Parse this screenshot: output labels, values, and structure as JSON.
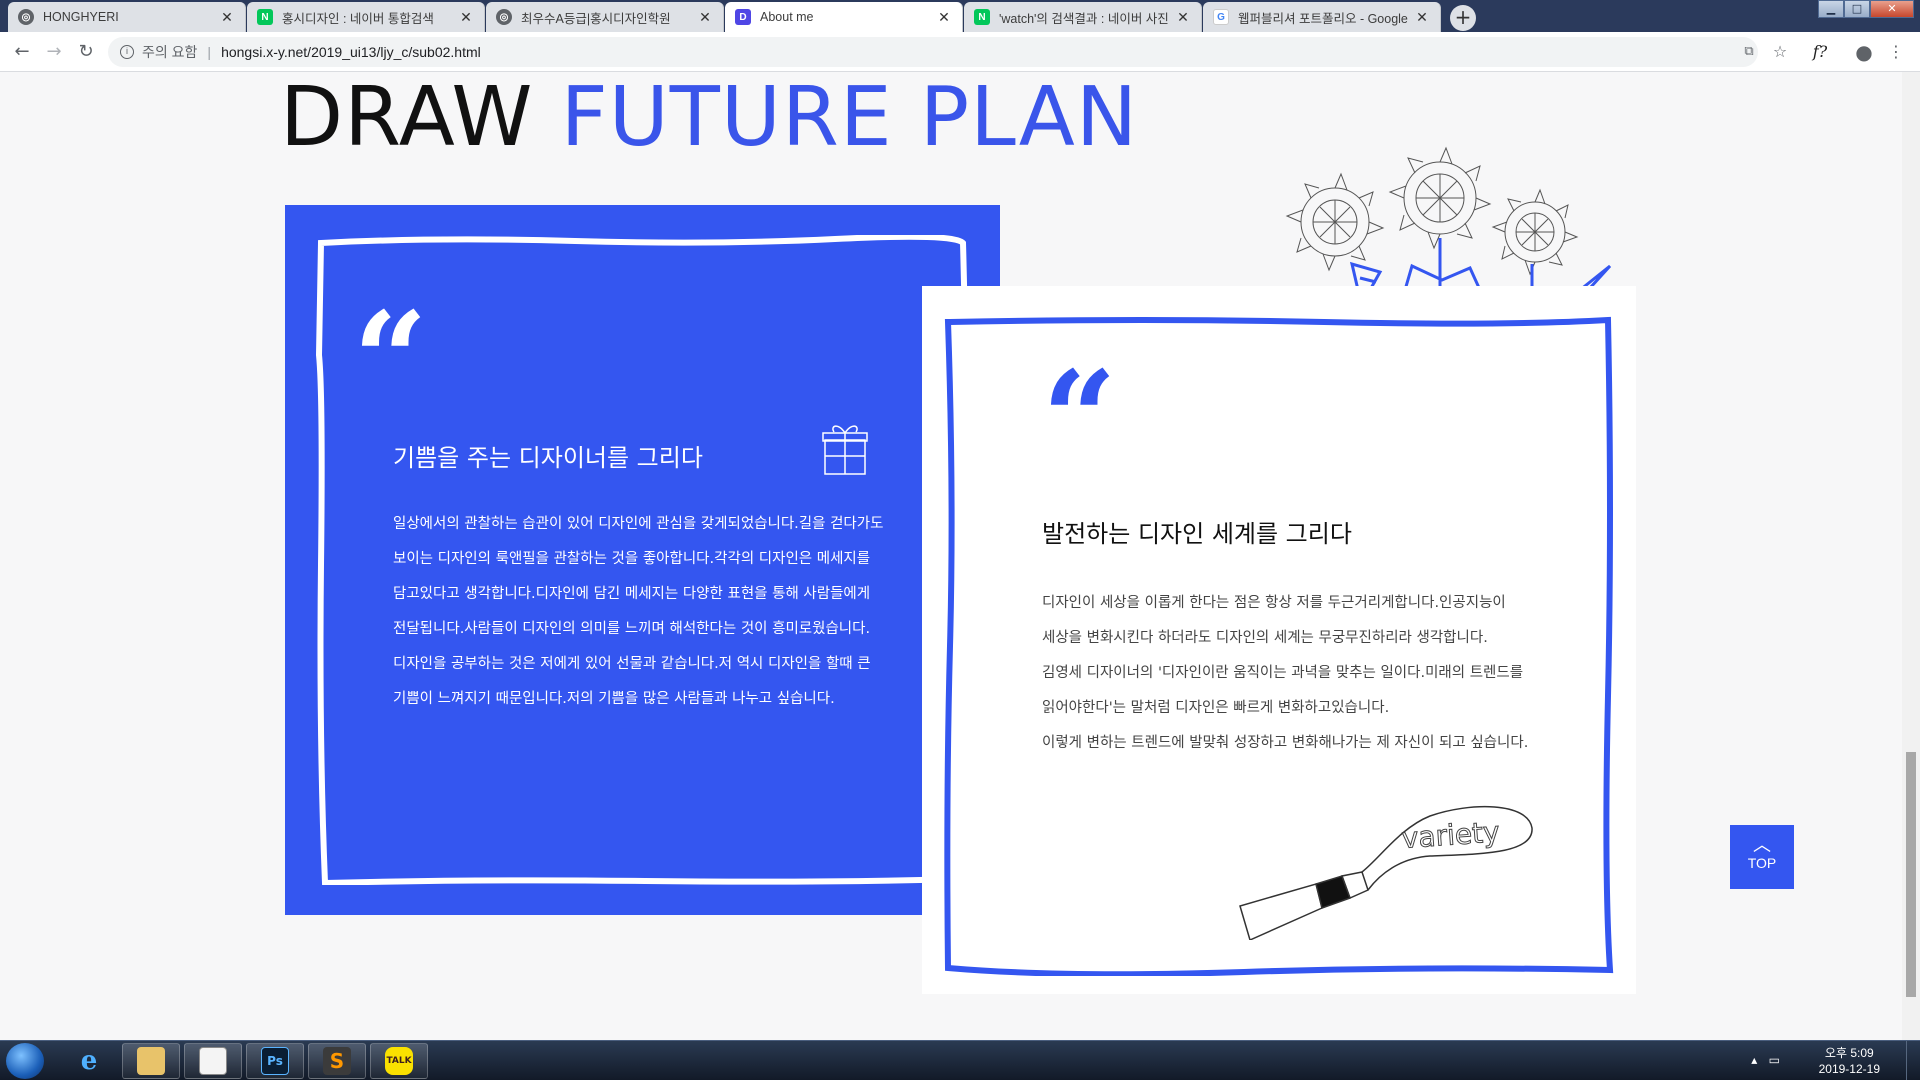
{
  "browser": {
    "tabs": [
      {
        "title": "HONGHYERI",
        "favicon": "globe-icon",
        "color": "#5f6368",
        "active": false
      },
      {
        "title": "홍시디자인 : 네이버 통합검색",
        "favicon": "naver-icon",
        "color": "#03c75a",
        "active": false
      },
      {
        "title": "최우수A등급|홍시디자인학원",
        "favicon": "globe-icon",
        "color": "#5f6368",
        "active": false
      },
      {
        "title": "About me",
        "favicon": "d-icon",
        "color": "#4f46e5",
        "active": true
      },
      {
        "title": "'watch'의 검색결과 : 네이버 사진",
        "favicon": "naver-photo-icon",
        "color": "#03c75a",
        "active": false
      },
      {
        "title": "웹퍼블리셔 포트폴리오 - Google",
        "favicon": "google-icon",
        "color": "#4285f4",
        "active": false
      }
    ],
    "security_label": "주의 요함",
    "url": "hongsi.x-y.net/2019_ui13/ljy_c/sub02.html"
  },
  "page": {
    "heading_black": "DRAW",
    "heading_blue": "FUTURE PLAN",
    "card1": {
      "quote": "“",
      "subtitle": "기쁨을 주는 디자이너를 그리다",
      "lines": [
        "일상에서의 관찰하는 습관이 있어 디자인에 관심을 갖게되었습니다.길을 걷다가도",
        "보이는 디자인의 룩앤필을 관찰하는 것을 좋아합니다.각각의 디자인은 메세지를",
        "담고있다고 생각합니다.디자인에 담긴 메세지는 다양한 표현을 통해 사람들에게",
        "전달됩니다.사람들이 디자인의 의미를 느끼며 해석한다는 것이 흥미로웠습니다.",
        "디자인을 공부하는 것은 저에게 있어 선물과 같습니다.저 역시 디자인을 할때 큰",
        "기쁨이 느껴지기 때문입니다.저의 기쁨을 많은 사람들과 나누고 싶습니다."
      ]
    },
    "card2": {
      "quote": "“",
      "subtitle": "발전하는 디자인 세계를 그리다",
      "lines": [
        "디자인이 세상을 이롭게 한다는 점은 항상 저를 두근거리게합니다.인공지능이",
        "세상을 변화시킨다 하더라도 디자인의 세계는 무궁무진하리라 생각합니다.",
        "김영세 디자이너의 '디자인이란 움직이는 과녁을 맞추는 일이다.미래의 트렌드를",
        "읽어야한다'는 말처럼 디자인은 빠르게 변화하고있습니다.",
        "이렇게 변하는 트렌드에 발맞춰 성장하고 변화해나가는 제 자신이 되고 싶습니다."
      ],
      "tube_text": "variety"
    },
    "top_button": "TOP",
    "accent": "#3456f0"
  },
  "taskbar": {
    "apps": [
      "ie-icon",
      "explorer-icon",
      "notepad-icon",
      "photoshop-icon",
      "sublime-icon",
      "kakaotalk-icon"
    ],
    "ps_label": "Ps",
    "talk_label": "TALK",
    "time": "오후 5:09",
    "date": "2019-12-19"
  }
}
